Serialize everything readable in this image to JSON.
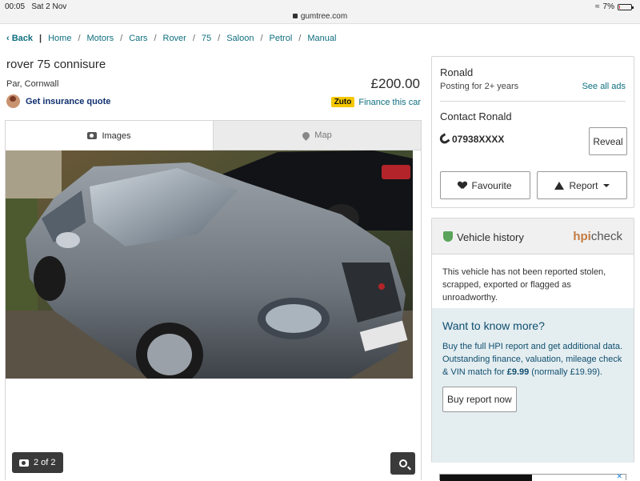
{
  "status": {
    "time": "00:05",
    "date": "Sat 2 Nov",
    "url": "gumtree.com",
    "battery": "7%",
    "battery_level": 0.07
  },
  "breadcrumb": {
    "back": "Back",
    "items": [
      "Home",
      "Motors",
      "Cars",
      "Rover",
      "75",
      "Saloon",
      "Petrol",
      "Manual"
    ]
  },
  "listing": {
    "title": "rover 75 connisure",
    "location": "Par, Cornwall",
    "price": "£200.00",
    "insurance_link": "Get insurance quote",
    "zuto_badge": "Zuto",
    "finance_link": "Finance this car"
  },
  "gallery": {
    "tab_images": "Images",
    "tab_map": "Map",
    "counter": "2 of 2"
  },
  "seller": {
    "name": "Ronald",
    "posting": "Posting for 2+ years",
    "see_all": "See all ads",
    "contact_title": "Contact Ronald",
    "phone": "07938XXXX",
    "reveal": "Reveal",
    "favourite": "Favourite",
    "report": "Report"
  },
  "history": {
    "title": "Vehicle history",
    "brand_h": "hpi",
    "brand_c": "check",
    "body": "This vehicle has not been reported stolen, scrapped, exported or flagged as unroadworthy.",
    "more_title": "Want to know more?",
    "more_p1": "Buy the full HPI report and get additional data.",
    "more_p2_a": "Outstanding finance, valuation, mileage check & VIN match for ",
    "more_price": "£9.99",
    "more_p2_b": " (normally £19.99).",
    "buy_button": "Buy report now"
  },
  "colors": {
    "link": "#0f6f7f",
    "zuto": "#f5c800",
    "info_bg": "#e4edf0"
  }
}
